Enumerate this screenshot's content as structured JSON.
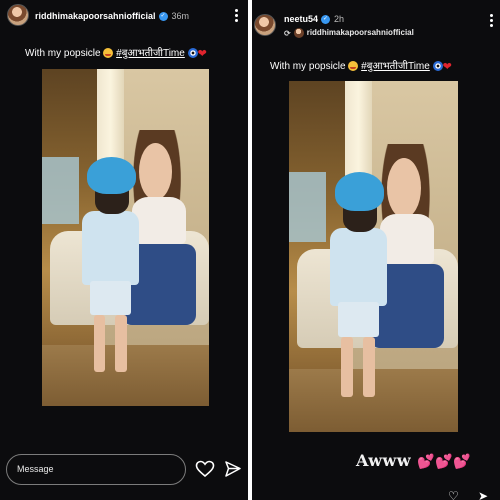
{
  "left_story": {
    "username": "riddhimakapoorsahniofficial",
    "time": "36m",
    "caption_text": "With my popsicle",
    "caption_tag": "#बुआभतीजीTime",
    "message_placeholder": "Message"
  },
  "right_story": {
    "username": "neetu54",
    "time": "2h",
    "reposted_from": "riddhimakapoorsahniofficial",
    "caption_text": "With my popsicle",
    "caption_tag": "#बुआभतीजीTime",
    "sticker_text": "Awww",
    "sticker_hearts": "💕💕💕"
  },
  "icons": {
    "verified": "verified-badge-icon",
    "more": "more-options-icon",
    "heart": "like-heart-icon",
    "send": "send-icon",
    "repost": "repost-icon"
  },
  "colors": {
    "background": "#0c0c0e",
    "verified": "#3897f0",
    "heart": "#e0242e",
    "sticker_hearts": "#e64ec8"
  }
}
